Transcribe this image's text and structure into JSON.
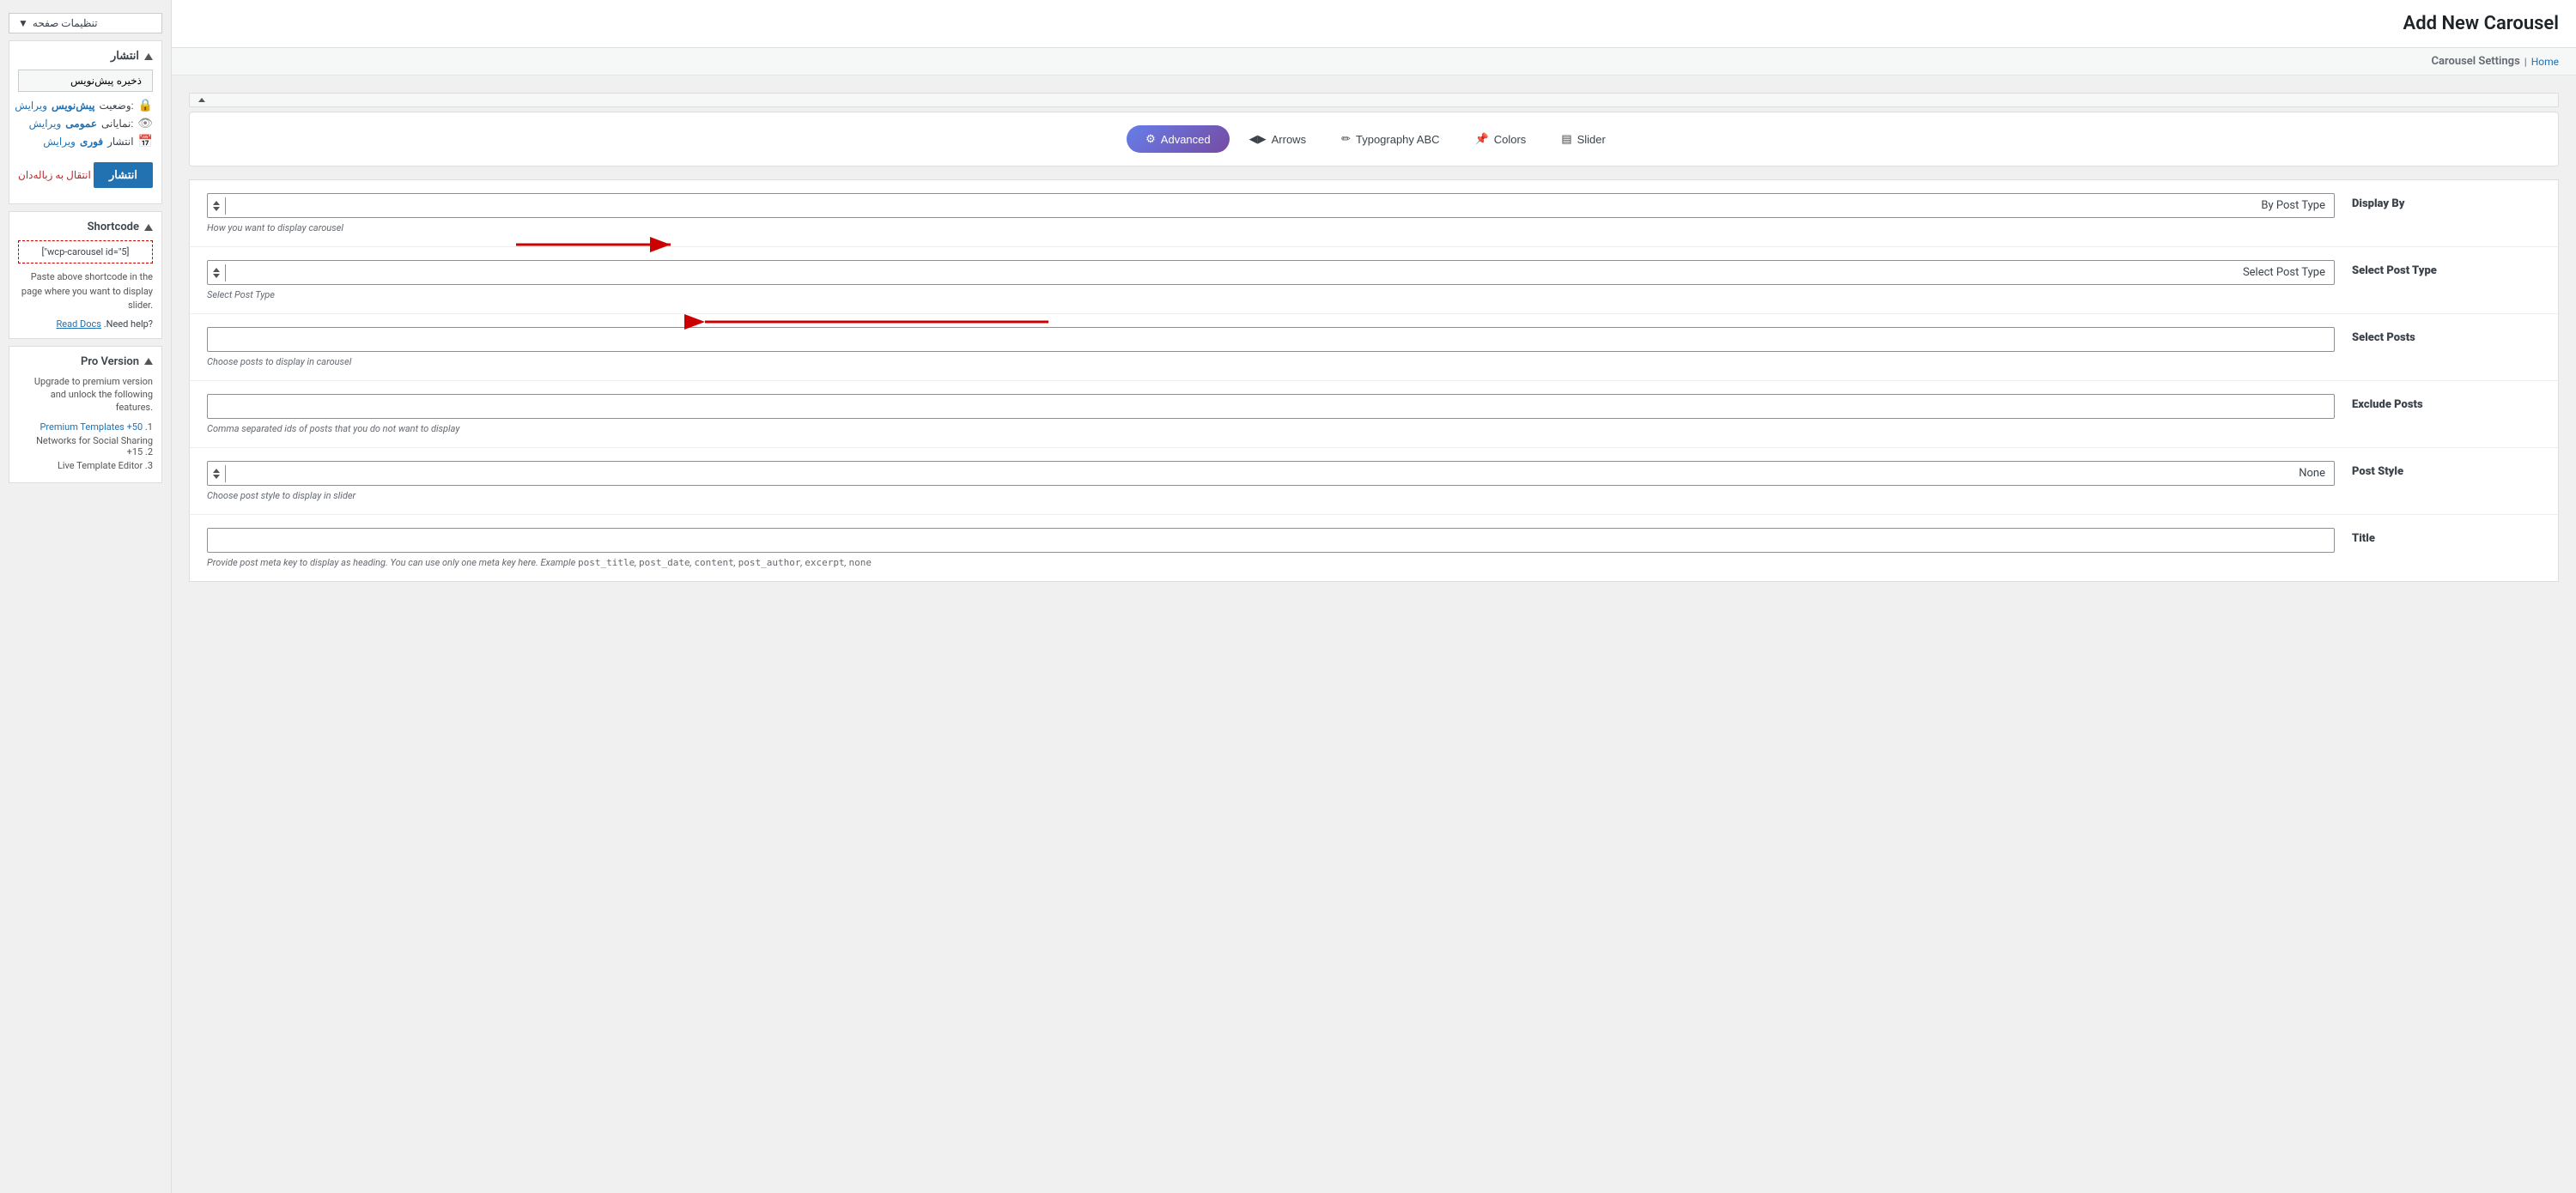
{
  "header": {
    "page_title": "Add New Carousel",
    "breadcrumb_home": "Home",
    "carousel_settings": "Carousel Settings"
  },
  "sidebar": {
    "page_settings_label": "تنظیمات صفحه",
    "publish_section": {
      "header": "انتشار",
      "save_draft_btn": "ذخیره پیش‌نویس",
      "status_label": "وضعیت:",
      "status_value": "پیش‌نویس",
      "status_link": "ویرایش",
      "visibility_label": "نمایانی:",
      "visibility_value": "عمومی",
      "visibility_link": "ویرایش",
      "publish_date_label": "انتشار",
      "publish_date_link": "فوری",
      "publish_date_edit": "ویرایش",
      "publish_btn": "انتشار",
      "trash_link": "انتقال به زباله‌دان"
    },
    "shortcode_section": {
      "header": "Shortcode",
      "shortcode_value": "[\"wcp-carousel id=\"5]",
      "description": "Paste above shortcode in the page where you want to display slider.",
      "help_text": ".Need help?",
      "read_docs_link": "Read Docs"
    },
    "pro_section": {
      "header": "Pro Version",
      "description": "Upgrade to premium version and unlock the following features.",
      "items": [
        "Premium Templates +50 .1",
        "Networks for Social Sharing +15 .2",
        "Live Template Editor .3"
      ]
    }
  },
  "tabs": [
    {
      "id": "advanced",
      "label": "Advanced",
      "icon": "⚙",
      "active": true
    },
    {
      "id": "arrows",
      "label": "Arrows",
      "icon": "◀▶",
      "active": false
    },
    {
      "id": "typography",
      "label": "Typography ABC",
      "icon": "✏",
      "active": false
    },
    {
      "id": "colors",
      "label": "Colors",
      "icon": "📌",
      "active": false
    },
    {
      "id": "slider",
      "label": "Slider",
      "icon": "▤",
      "active": false
    }
  ],
  "settings": [
    {
      "id": "display-by",
      "label": "Display By",
      "control_type": "select",
      "value": "By Post Type",
      "hint": "How you want to display carousel"
    },
    {
      "id": "select-post-type",
      "label": "Select Post Type",
      "control_type": "select",
      "value": "Select Post Type",
      "hint": "Select Post Type"
    },
    {
      "id": "select-posts",
      "label": "Select Posts",
      "control_type": "text",
      "value": "",
      "placeholder": "",
      "hint": "Choose posts to display in carousel"
    },
    {
      "id": "exclude-posts",
      "label": "Exclude Posts",
      "control_type": "text",
      "value": "",
      "placeholder": "",
      "hint": "Comma separated ids of posts that you do not want to display"
    },
    {
      "id": "post-style",
      "label": "Post Style",
      "control_type": "select",
      "value": "None",
      "hint": "Choose post style to display in slider"
    },
    {
      "id": "title",
      "label": "Title",
      "control_type": "text",
      "value": "",
      "placeholder": "",
      "hint": "Provide post meta key to display as heading. You can use only one meta key here. Example post_title, post_date, content, post_author, excerpt, none"
    }
  ],
  "annotations": {
    "arrow1_tip": "By Post Type",
    "arrow2_tip": "Select Post Type"
  }
}
